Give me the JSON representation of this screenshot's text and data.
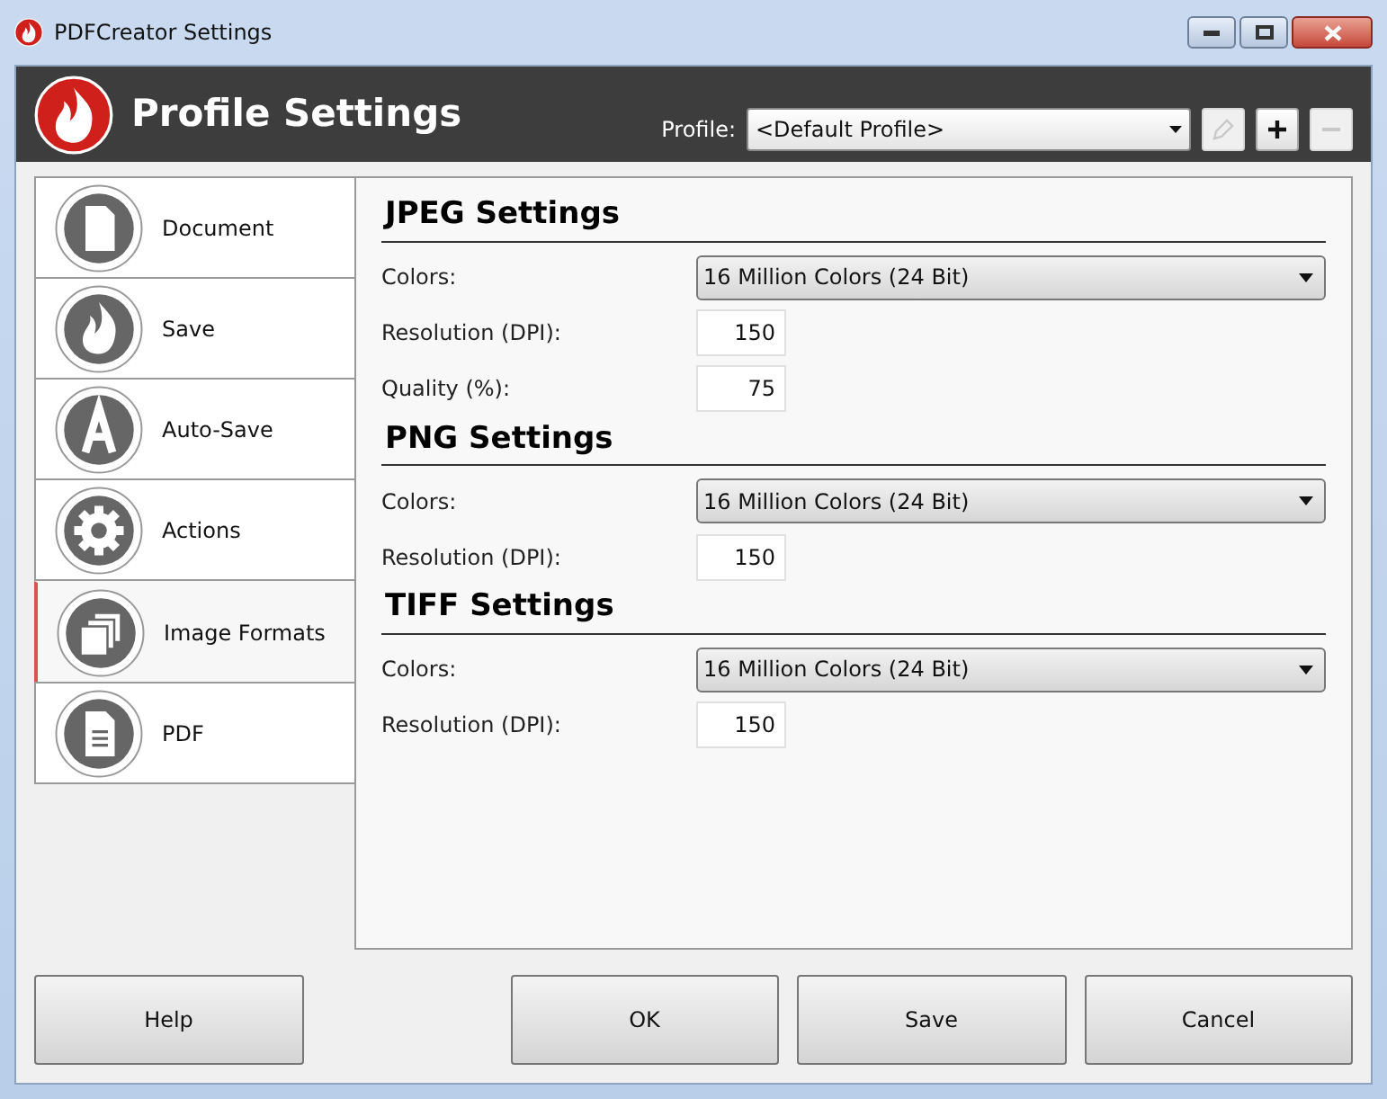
{
  "window": {
    "title": "PDFCreator Settings"
  },
  "header": {
    "title": "Profile Settings",
    "profile_label": "Profile:",
    "profile_value": "<Default Profile>",
    "buttons": [
      {
        "kind": "edit",
        "disabled": true
      },
      {
        "kind": "add",
        "disabled": false
      },
      {
        "kind": "remove",
        "disabled": true
      }
    ]
  },
  "sidebar": {
    "items": [
      {
        "label": "Document",
        "kind": "document",
        "selected": false
      },
      {
        "label": "Save",
        "kind": "flame",
        "selected": false
      },
      {
        "label": "Auto-Save",
        "kind": "letter",
        "selected": false
      },
      {
        "label": "Actions",
        "kind": "gear",
        "selected": false
      },
      {
        "label": "Image Formats",
        "kind": "images",
        "selected": true
      },
      {
        "label": "PDF",
        "kind": "pdf",
        "selected": false
      }
    ]
  },
  "sections": [
    {
      "title": "JPEG Settings",
      "fields": [
        {
          "label": "Colors:",
          "kind": "select",
          "value": "16 Million Colors (24 Bit)"
        },
        {
          "label": "Resolution (DPI):",
          "kind": "number",
          "value": "150"
        },
        {
          "label": "Quality (%):",
          "kind": "number",
          "value": "75"
        }
      ]
    },
    {
      "title": "PNG Settings",
      "fields": [
        {
          "label": "Colors:",
          "kind": "select",
          "value": "16 Million Colors (24 Bit)"
        },
        {
          "label": "Resolution (DPI):",
          "kind": "number",
          "value": "150"
        }
      ]
    },
    {
      "title": "TIFF Settings",
      "fields": [
        {
          "label": "Colors:",
          "kind": "select",
          "value": "16 Million Colors (24 Bit)"
        },
        {
          "label": "Resolution (DPI):",
          "kind": "number",
          "value": "150"
        }
      ]
    }
  ],
  "footer": {
    "buttons": [
      "Help",
      "OK",
      "Save",
      "Cancel"
    ]
  }
}
